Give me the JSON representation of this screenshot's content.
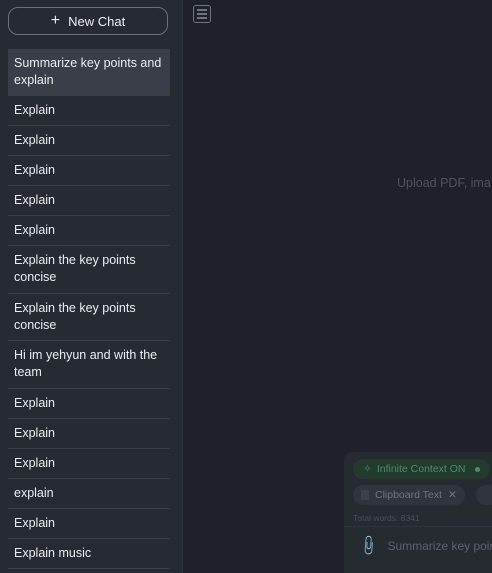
{
  "sidebar": {
    "new_chat_label": "New Chat",
    "items": [
      {
        "label": "Summarize key points and explain",
        "active": true
      },
      {
        "label": "Explain"
      },
      {
        "label": "Explain"
      },
      {
        "label": "Explain"
      },
      {
        "label": "Explain"
      },
      {
        "label": "Explain"
      },
      {
        "label": "Explain the key points concise"
      },
      {
        "label": "Explain the key points concise"
      },
      {
        "label": "Hi im yehyun and with the team"
      },
      {
        "label": "Explain"
      },
      {
        "label": "Explain"
      },
      {
        "label": "Explain"
      },
      {
        "label": "explain"
      },
      {
        "label": "Explain"
      },
      {
        "label": "Explain music"
      }
    ]
  },
  "main": {
    "upload_hint": "Upload PDF, ima"
  },
  "composer": {
    "context_pill": "Infinite Context ON",
    "clipboard_pill": "Clipboard Text",
    "clipboard_close": "✕",
    "word_count": "Total words: 8341",
    "input_text": "Summarize key poin"
  },
  "colors": {
    "sidebar_bg": "#262a33",
    "main_bg": "#1e2129",
    "accent_green": "#4c8e66"
  }
}
